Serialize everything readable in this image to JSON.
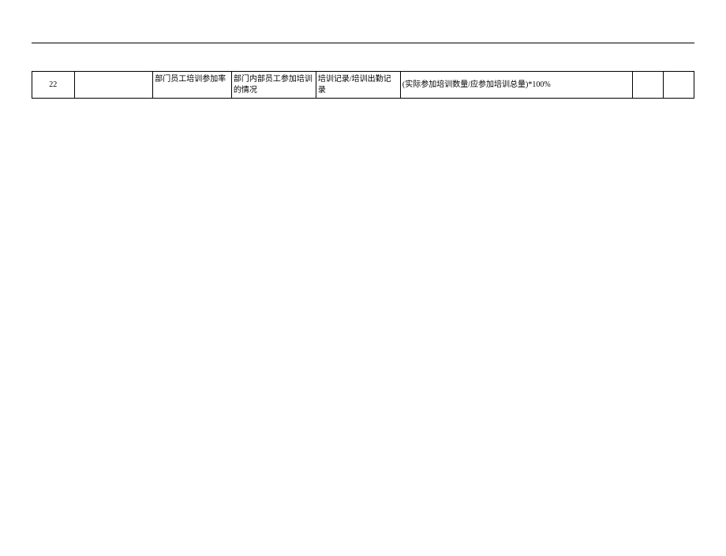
{
  "row": {
    "seq": "22",
    "col_a": "",
    "col_b": "部门员工培训参加率",
    "col_c": "部门内部员工参加培训的情况",
    "col_d": "培训记录/培训出勤记录",
    "formula": "(实际参加培训数量/应参加培训总量)*100%",
    "col_f": "",
    "col_g": ""
  }
}
